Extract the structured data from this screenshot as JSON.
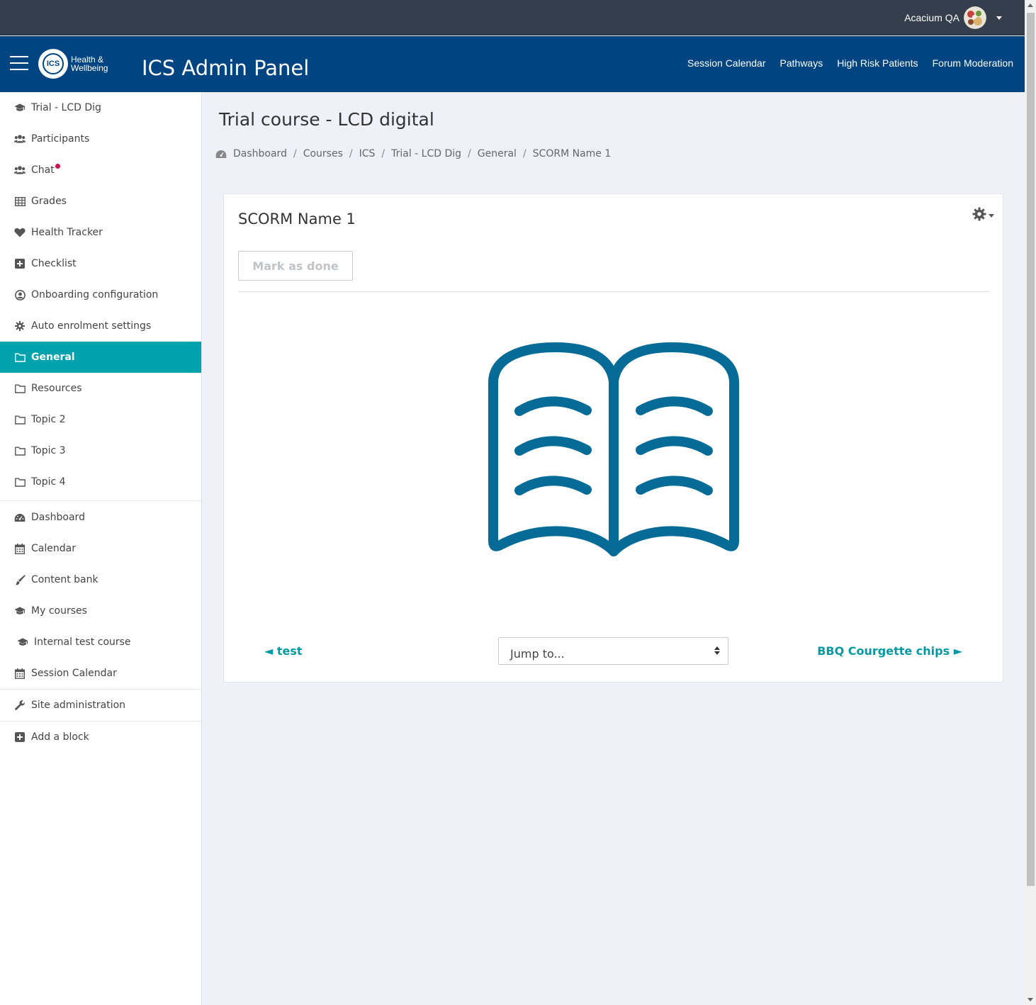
{
  "topbar": {
    "user_name": "Acacium QA",
    "avatar_icon": "user-avatar-icon"
  },
  "header": {
    "logo_line1": "Health &",
    "logo_line2": "Wellbeing",
    "logo_mark": "ICS",
    "app_title": "ICS Admin Panel",
    "nav": [
      "Session Calendar",
      "Pathways",
      "High Risk Patients",
      "Forum Moderation"
    ]
  },
  "sidebar": {
    "course_items": [
      {
        "label": "Trial - LCD Dig",
        "icon": "graduation-cap-icon"
      },
      {
        "label": "Participants",
        "icon": "users-icon"
      },
      {
        "label": "Chat",
        "icon": "users-icon",
        "notification": true
      },
      {
        "label": "Grades",
        "icon": "table-icon"
      },
      {
        "label": "Health Tracker",
        "icon": "heart-icon"
      },
      {
        "label": "Checklist",
        "icon": "plus-square-icon"
      },
      {
        "label": "Onboarding configuration",
        "icon": "user-circle-icon"
      },
      {
        "label": "Auto enrolment settings",
        "icon": "cog-icon"
      },
      {
        "label": "General",
        "icon": "folder-icon",
        "active": true
      },
      {
        "label": "Resources",
        "icon": "folder-icon"
      },
      {
        "label": "Topic 2",
        "icon": "folder-icon"
      },
      {
        "label": "Topic 3",
        "icon": "folder-icon"
      },
      {
        "label": "Topic 4",
        "icon": "folder-icon"
      }
    ],
    "site_items": [
      {
        "label": "Dashboard",
        "icon": "dashboard-icon"
      },
      {
        "label": "Calendar",
        "icon": "calendar-icon"
      },
      {
        "label": "Content bank",
        "icon": "brush-icon"
      },
      {
        "label": "My courses",
        "icon": "graduation-cap-icon"
      },
      {
        "label": "Internal test course",
        "icon": "graduation-cap-icon"
      },
      {
        "label": "Session Calendar",
        "icon": "calendar-icon"
      }
    ],
    "admin_item": {
      "label": "Site administration",
      "icon": "wrench-icon"
    },
    "block_item": {
      "label": "Add a block",
      "icon": "plus-square-icon"
    }
  },
  "main": {
    "page_title": "Trial course - LCD digital",
    "breadcrumb": [
      "Dashboard",
      "Courses",
      "ICS",
      "Trial - LCD Dig",
      "General",
      "SCORM Name 1"
    ],
    "card": {
      "title": "SCORM Name 1",
      "mark_done": "Mark as done",
      "prev_link": "◄ test",
      "next_link": "BBQ Courgette chips ►",
      "jump_placeholder": "Jump to..."
    }
  },
  "colors": {
    "topbar": "#353e4c",
    "header": "#014482",
    "accent": "#00a2ad",
    "book": "#066b96",
    "notification": "#d01050"
  }
}
